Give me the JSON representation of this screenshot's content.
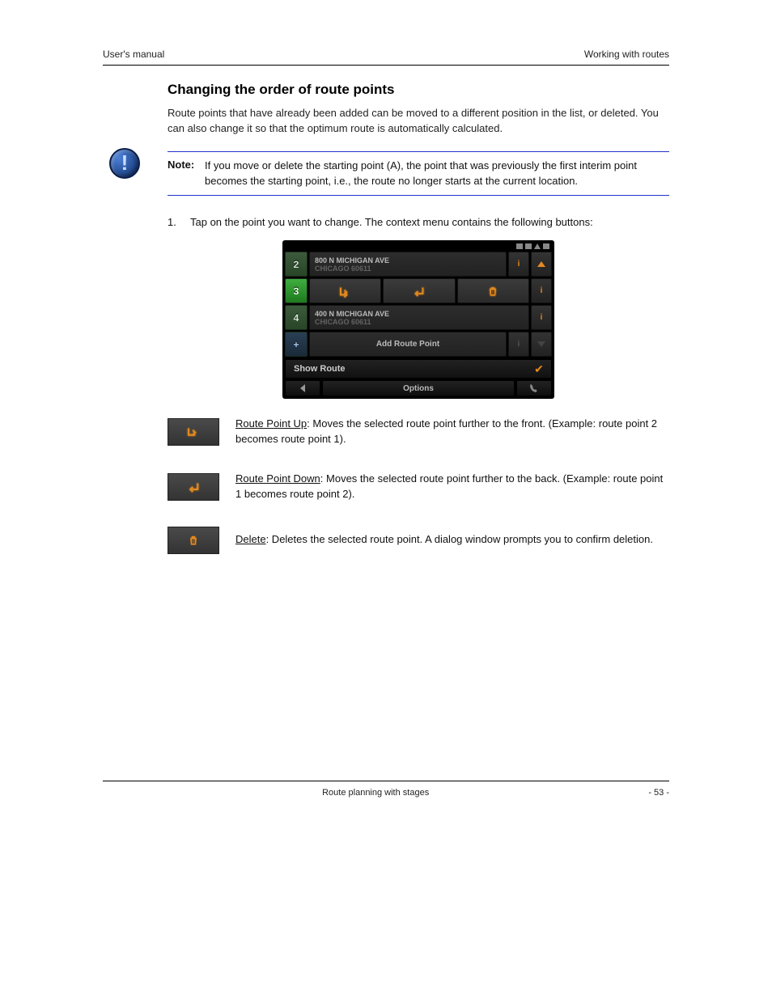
{
  "header": {
    "left": "User's manual",
    "right": "Working with routes"
  },
  "section_title": "Changing the order of route points",
  "intro": "Route points that have already been added can be moved to a different position in the list, or deleted. You can also change it so that the optimum route is automatically calculated.",
  "note": {
    "label": "Note:",
    "text": "If you move or delete the starting point (A), the point that was previously the first interim point becomes the starting point, i.e., the route no longer starts at the current location."
  },
  "step": {
    "num": "1.",
    "text": "Tap on the point you want to change. The context menu contains the following buttons:"
  },
  "device": {
    "rows": [
      {
        "badge": "2",
        "line1": "800 N MICHIGAN AVE",
        "line2": "CHICAGO 60611"
      },
      {
        "badge": "3",
        "active": true
      },
      {
        "badge": "4",
        "line1": "400 N MICHIGAN AVE",
        "line2": "CHICAGO 60611"
      },
      {
        "badge": "+",
        "plus": true,
        "single": "Add Route Point"
      }
    ],
    "show_route": "Show Route",
    "bottom_options": "Options"
  },
  "legend": [
    {
      "key": "up",
      "desc_pre": "Route Point Up",
      "desc_post": ": Moves the selected route point further to the front. (Example: route point 2 becomes route point 1)."
    },
    {
      "key": "down",
      "desc_pre": "Route Point Down",
      "desc_post": ": Moves the selected route point further to the back. (Example: route point 1 becomes route point 2)."
    },
    {
      "key": "delete",
      "desc_pre": "Delete",
      "desc_post": ": Deletes the selected route point. A dialog window prompts you to confirm deletion."
    }
  ],
  "footer": {
    "left": "",
    "center": "Route planning with stages",
    "right": "- 53 -"
  }
}
